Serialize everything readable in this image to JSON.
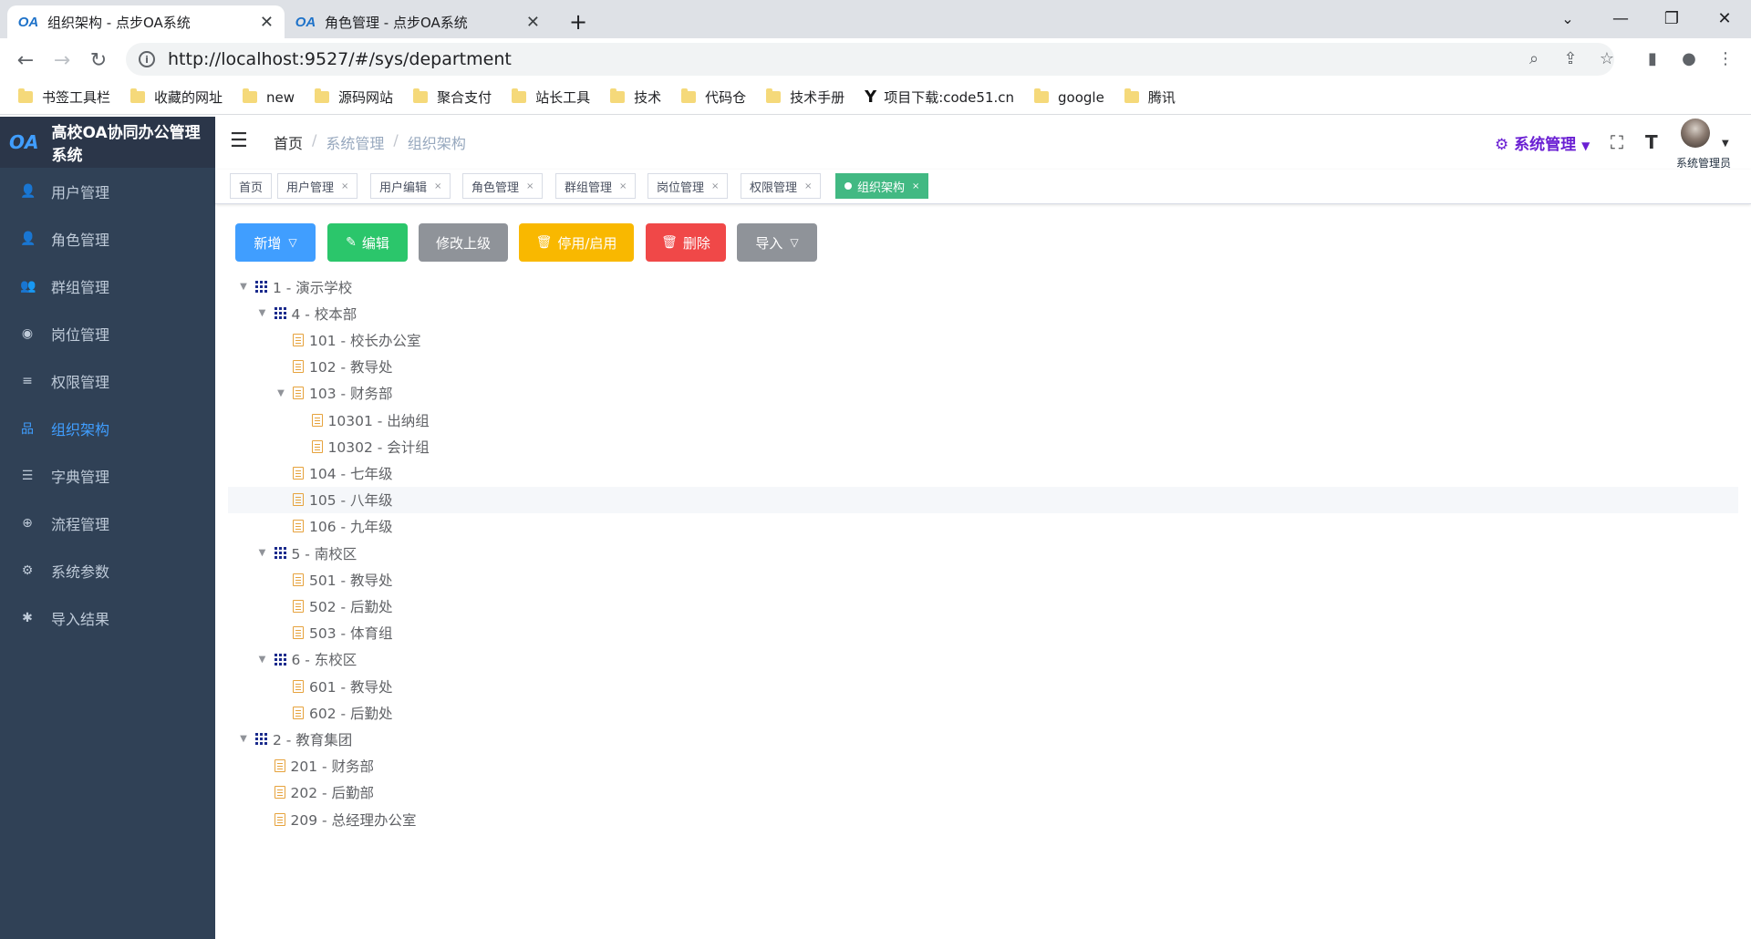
{
  "browser": {
    "tabs": [
      {
        "title": "组织架构 - 点步OA系统",
        "favicon": "OA"
      },
      {
        "title": "角色管理 - 点步OA系统",
        "favicon": "OA"
      }
    ],
    "new_tab": "+",
    "url": "http://localhost:9527/#/sys/department",
    "bookmarks": [
      "书签工具栏",
      "收藏的网址",
      "new",
      "源码网站",
      "聚合支付",
      "站长工具",
      "技术",
      "代码仓",
      "技术手册",
      "项目下载:code51.cn",
      "google",
      "腾讯"
    ]
  },
  "app": {
    "title": "高校OA协同办公管理系统",
    "logo": "OA",
    "menu": [
      {
        "label": "用户管理",
        "icon": "user-icon",
        "glyph": "👤"
      },
      {
        "label": "角色管理",
        "icon": "role-icon",
        "glyph": "👤"
      },
      {
        "label": "群组管理",
        "icon": "group-icon",
        "glyph": "👥"
      },
      {
        "label": "岗位管理",
        "icon": "post-icon",
        "glyph": "◉"
      },
      {
        "label": "权限管理",
        "icon": "list-icon",
        "glyph": "≡"
      },
      {
        "label": "组织架构",
        "icon": "org-icon",
        "glyph": "品",
        "active": true
      },
      {
        "label": "字典管理",
        "icon": "dict-icon",
        "glyph": "☰"
      },
      {
        "label": "流程管理",
        "icon": "flow-icon",
        "glyph": "⊕"
      },
      {
        "label": "系统参数",
        "icon": "gear-icon",
        "glyph": "⚙"
      },
      {
        "label": "导入结果",
        "icon": "bug-icon",
        "glyph": "✱"
      }
    ],
    "breadcrumb": [
      "首页",
      "系统管理",
      "组织架构"
    ],
    "system_menu": "系统管理",
    "username": "系统管理员",
    "tags": [
      {
        "label": "首页",
        "closable": false
      },
      {
        "label": "用户管理",
        "closable": true
      },
      {
        "label": "用户编辑",
        "closable": true
      },
      {
        "label": "角色管理",
        "closable": true
      },
      {
        "label": "群组管理",
        "closable": true
      },
      {
        "label": "岗位管理",
        "closable": true
      },
      {
        "label": "权限管理",
        "closable": true
      },
      {
        "label": "组织架构",
        "closable": true,
        "active": true
      }
    ],
    "buttons": {
      "add": "新增",
      "edit": "编辑",
      "change_parent": "修改上级",
      "toggle": "停用/启用",
      "delete": "删除",
      "import": "导入"
    },
    "colors": {
      "primary": "#409eff",
      "success": "#2bc66b",
      "info": "#8f9399",
      "warning": "#f9b800",
      "danger": "#f04848",
      "sidebar": "#304156",
      "tag_active": "#42b983"
    },
    "tree": [
      {
        "label": "1 - 演示学校",
        "level": 0,
        "type": "group",
        "expanded": true
      },
      {
        "label": "4 - 校本部",
        "level": 1,
        "type": "group",
        "expanded": true
      },
      {
        "label": "101 - 校长办公室",
        "level": 2,
        "type": "dept"
      },
      {
        "label": "102 - 教导处",
        "level": 2,
        "type": "dept"
      },
      {
        "label": "103 - 财务部",
        "level": 2,
        "type": "dept",
        "expanded": true
      },
      {
        "label": "10301 - 出纳组",
        "level": 3,
        "type": "dept"
      },
      {
        "label": "10302 - 会计组",
        "level": 3,
        "type": "dept"
      },
      {
        "label": "104 - 七年级",
        "level": 2,
        "type": "dept"
      },
      {
        "label": "105 - 八年级",
        "level": 2,
        "type": "dept",
        "highlighted": true
      },
      {
        "label": "106 - 九年级",
        "level": 2,
        "type": "dept"
      },
      {
        "label": "5 - 南校区",
        "level": 1,
        "type": "group",
        "expanded": true
      },
      {
        "label": "501 - 教导处",
        "level": 2,
        "type": "dept"
      },
      {
        "label": "502 - 后勤处",
        "level": 2,
        "type": "dept"
      },
      {
        "label": "503 - 体育组",
        "level": 2,
        "type": "dept"
      },
      {
        "label": "6 - 东校区",
        "level": 1,
        "type": "group",
        "expanded": true
      },
      {
        "label": "601 - 教导处",
        "level": 2,
        "type": "dept"
      },
      {
        "label": "602 - 后勤处",
        "level": 2,
        "type": "dept"
      },
      {
        "label": "2 - 教育集团",
        "level": 0,
        "type": "group",
        "expanded": true
      },
      {
        "label": "201 - 财务部",
        "level": 1,
        "type": "dept"
      },
      {
        "label": "202 - 后勤部",
        "level": 1,
        "type": "dept"
      },
      {
        "label": "209 - 总经理办公室",
        "level": 1,
        "type": "dept"
      }
    ]
  }
}
